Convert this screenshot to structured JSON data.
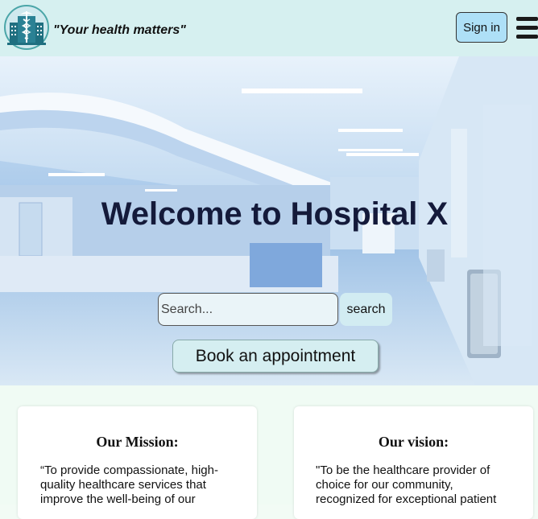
{
  "header": {
    "tagline": "\"Your health matters\"",
    "signin_label": "Sign in",
    "logo_icon": "hospital-caduceus-logo",
    "menu_icon": "hamburger-menu-icon"
  },
  "hero": {
    "title": "Welcome to Hospital X",
    "search_placeholder": "Search...",
    "search_label": "search",
    "book_label": "Book an appointment"
  },
  "cards": {
    "mission": {
      "title": "Our Mission:",
      "lines": [
        "“To provide compassionate, high-",
        "quality healthcare services that",
        "improve the well-being of our"
      ]
    },
    "vision": {
      "title": "Our vision:",
      "lines": [
        "\"To be the healthcare provider of",
        "choice for our community,",
        "recognized for exceptional patient"
      ]
    }
  },
  "colors": {
    "header_bg": "#d6f0f0",
    "signin_bg": "#aee0f7",
    "title_color": "#141a3a"
  }
}
